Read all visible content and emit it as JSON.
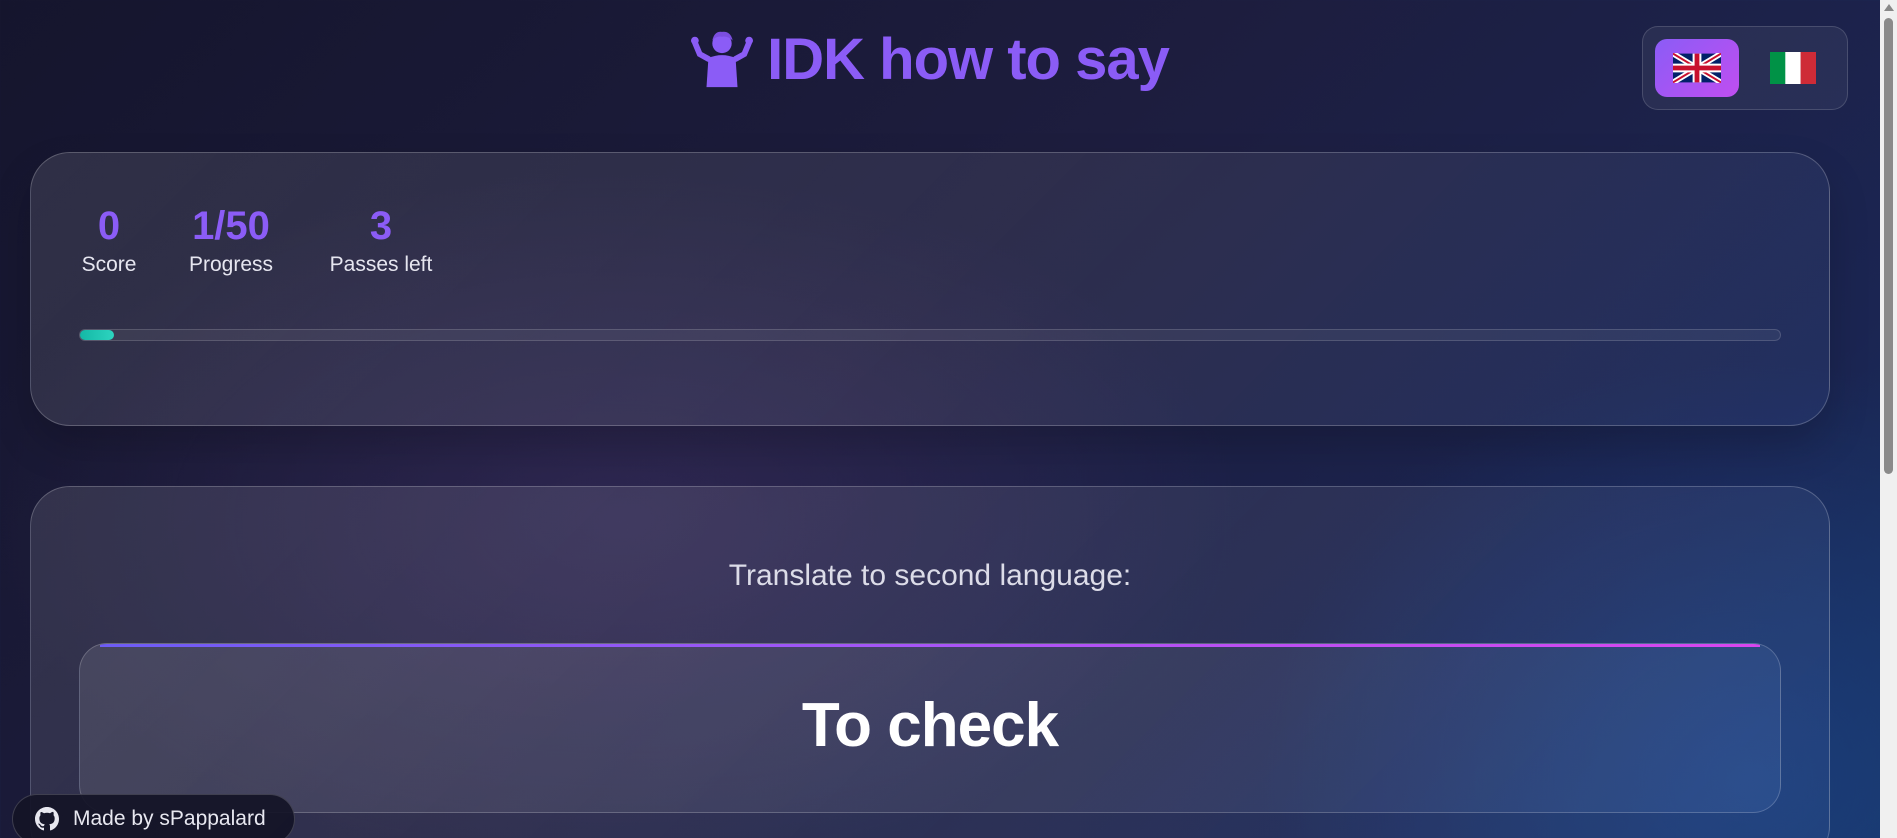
{
  "header": {
    "title": "IDK how to say",
    "title_icon": "person-shrugging-icon"
  },
  "language_switcher": {
    "options": [
      {
        "label": "English",
        "icon": "uk-flag-icon",
        "active": true
      },
      {
        "label": "Italiano",
        "icon": "italy-flag-icon",
        "active": false
      }
    ]
  },
  "stats": {
    "score": {
      "value": "0",
      "label": "Score"
    },
    "progress": {
      "value": "1/50",
      "label": "Progress"
    },
    "passes": {
      "value": "3",
      "label": "Passes left"
    },
    "progress_fraction": 0.02
  },
  "quiz": {
    "prompt": "Translate to second language:",
    "word": "To check"
  },
  "footer": {
    "credit": "Made by sPappalard",
    "icon": "github-icon"
  },
  "colors": {
    "accent": "#8b5cf6",
    "accent_pink": "#c04ef0",
    "progress": "#14b8a6",
    "background": "#1d1d3e"
  }
}
